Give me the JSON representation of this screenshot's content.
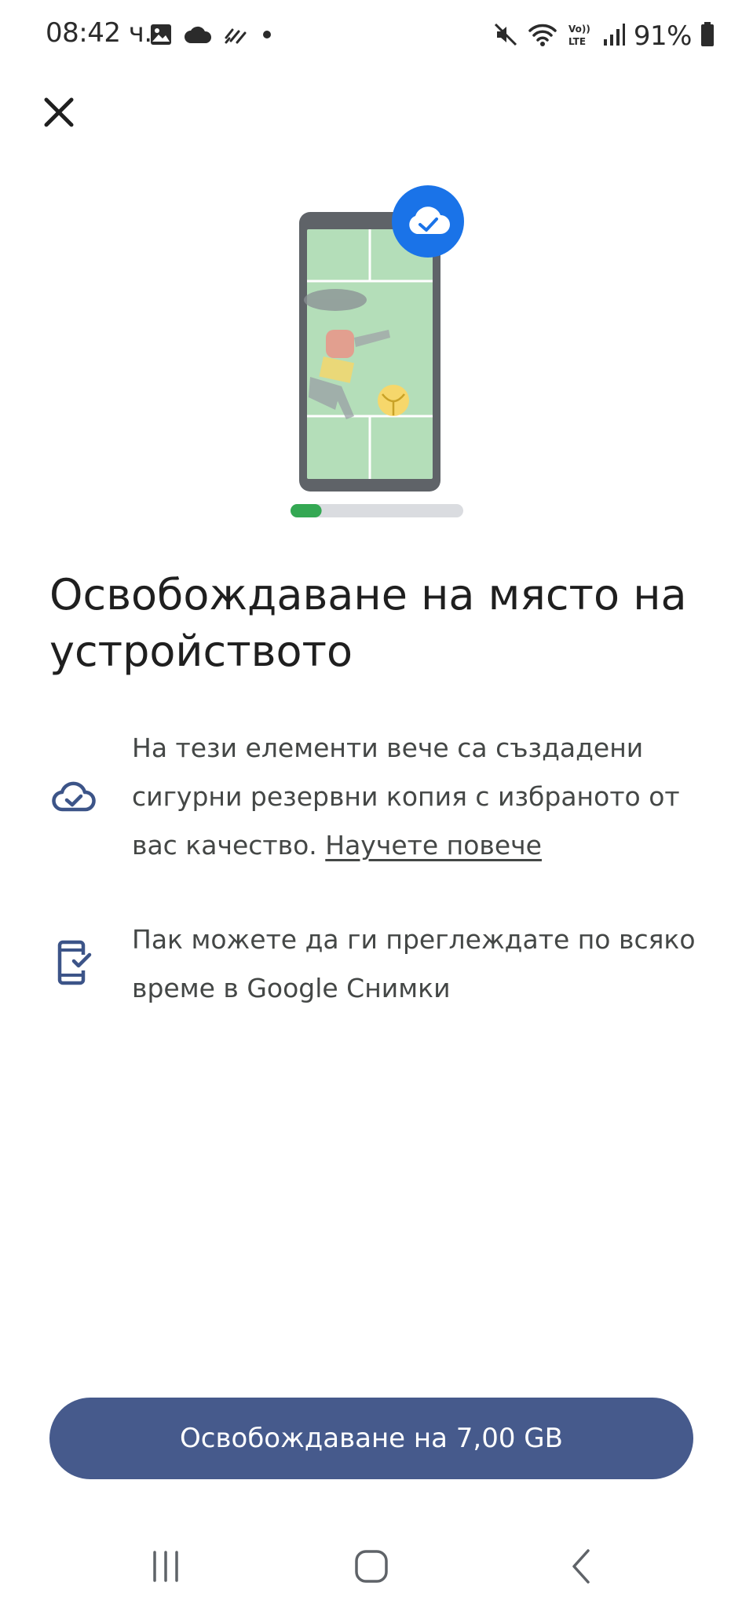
{
  "status_bar": {
    "time": "08:42 ч.",
    "battery": "91%",
    "left_icons": [
      "image-icon",
      "cloud-icon",
      "sync-icon",
      "dot-icon"
    ],
    "right_icons": [
      "mute-icon",
      "wifi-icon",
      "volte-icon",
      "signal-icon",
      "battery-icon"
    ]
  },
  "dialog": {
    "close_icon": "close-icon",
    "title": "Освобождаване на място на устройството",
    "items": [
      {
        "icon": "cloud-check-icon",
        "text": "На тези елементи вече са създадени сигурни резервни копия с избраното от вас качество.",
        "link": "Научете повече"
      },
      {
        "icon": "phone-check-icon",
        "text": "Пак можете да ги преглеждате по всяко време в Google Снимки"
      }
    ],
    "progress_fraction": 0.18,
    "primary_button": "Освобождаване на 7,00 GB"
  },
  "nav_bar": {
    "icons": [
      "recent-apps-icon",
      "home-icon",
      "back-icon"
    ]
  },
  "colors": {
    "primary": "#465a8c",
    "badge": "#1a73e8",
    "progress": "#34a853",
    "icon": "#3c5488"
  }
}
